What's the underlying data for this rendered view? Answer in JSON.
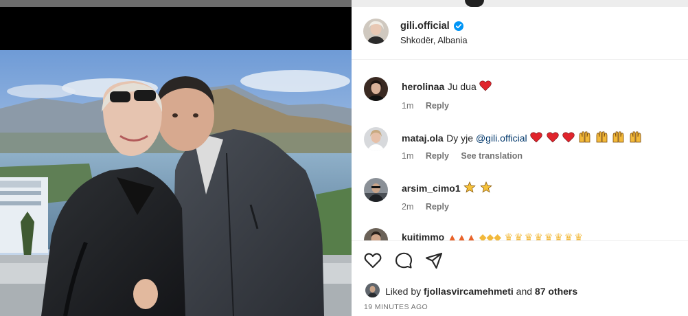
{
  "post": {
    "author": "gili.official",
    "location": "Shkodër, Albania",
    "verified": true
  },
  "comments": [
    {
      "user": "herolinaa",
      "text": "Ju dua",
      "emojis": [
        "heart"
      ],
      "time": "1m",
      "reply": "Reply"
    },
    {
      "user": "mataj.ola",
      "text": "Dy yje ",
      "mention": "@gili.official",
      "emojis": [
        "heart",
        "heart",
        "heart",
        "hands",
        "hands",
        "hands",
        "hands"
      ],
      "time": "1m",
      "reply": "Reply",
      "translate": "See translation"
    },
    {
      "user": "arsim_cimo1",
      "text": "",
      "emojis": [
        "star",
        "star"
      ],
      "time": "2m",
      "reply": "Reply"
    },
    {
      "user": "kujtimmo",
      "text": "",
      "emojis": [
        "fire",
        "fire",
        "fire",
        "clap",
        "clap",
        "clap",
        "crown",
        "crown",
        "crown",
        "crown",
        "crown",
        "crown",
        "crown",
        "crown"
      ]
    }
  ],
  "likes": {
    "prefix": "Liked by ",
    "user": "fjollasvircamehmeti",
    "mid": " and ",
    "count": "87 others"
  },
  "timestamp": "19 MINUTES AGO",
  "icons": {
    "like": "heart-outline-icon",
    "comment": "comment-bubble-icon",
    "share": "paper-plane-icon",
    "verified": "verified-badge-icon"
  },
  "colors": {
    "verified": "#0095f6",
    "heart": "#e0242c",
    "mention": "#00376b",
    "meta": "#737373"
  }
}
